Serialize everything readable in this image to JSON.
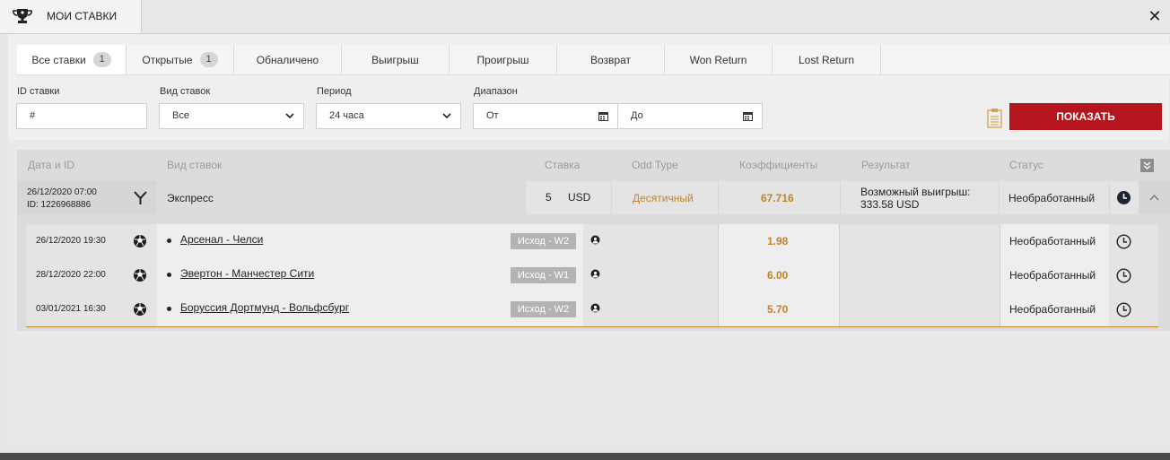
{
  "window": {
    "title": "МОИ СТАВКИ"
  },
  "tabs": [
    {
      "label": "Все ставки",
      "count": "1"
    },
    {
      "label": "Открытые",
      "count": "1"
    },
    {
      "label": "Обналичено"
    },
    {
      "label": "Выигрыш"
    },
    {
      "label": "Проигрыш"
    },
    {
      "label": "Возврат"
    },
    {
      "label": "Won Return"
    },
    {
      "label": "Lost Return"
    }
  ],
  "filters": {
    "id_label": "ID ставки",
    "id_value": "#",
    "type_label": "Вид ставок",
    "type_value": "Все",
    "period_label": "Период",
    "period_value": "24 часа",
    "range_label": "Диапазон",
    "from_value": "От",
    "to_value": "До",
    "show_button": "ПОКАЗАТЬ"
  },
  "columns": [
    "Дата и ID",
    "Вид ставок",
    "Ставка",
    "Odd Type",
    "Коэффициенты",
    "Результат",
    "Статус"
  ],
  "bet": {
    "date": "26/12/2020 07:00",
    "id": "ID: 1226968886",
    "type": "Экспресс",
    "stake": "5",
    "currency": "USD",
    "odd_type": "Десятичный",
    "odds": "67.716",
    "result_line1": "Возможный выигрыш:",
    "result_line2": "333.58 USD",
    "status": "Необработанный"
  },
  "selections": [
    {
      "date": "26/12/2020 19:30",
      "match": "Арсенал - Челси",
      "outcome": "Исход - W2",
      "odds": "1.98",
      "status": "Необработанный"
    },
    {
      "date": "28/12/2020 22:00",
      "match": "Эвертон - Манчестер Сити",
      "outcome": "Исход - W1",
      "odds": "6.00",
      "status": "Необработанный"
    },
    {
      "date": "03/01/2021 16:30",
      "match": "Боруссия Дортмунд - Вольфсбург",
      "outcome": "Исход - W2",
      "odds": "5.70",
      "status": "Необработанный"
    }
  ],
  "colors": {
    "accent": "#b5161d",
    "gold": "#c0832a"
  }
}
